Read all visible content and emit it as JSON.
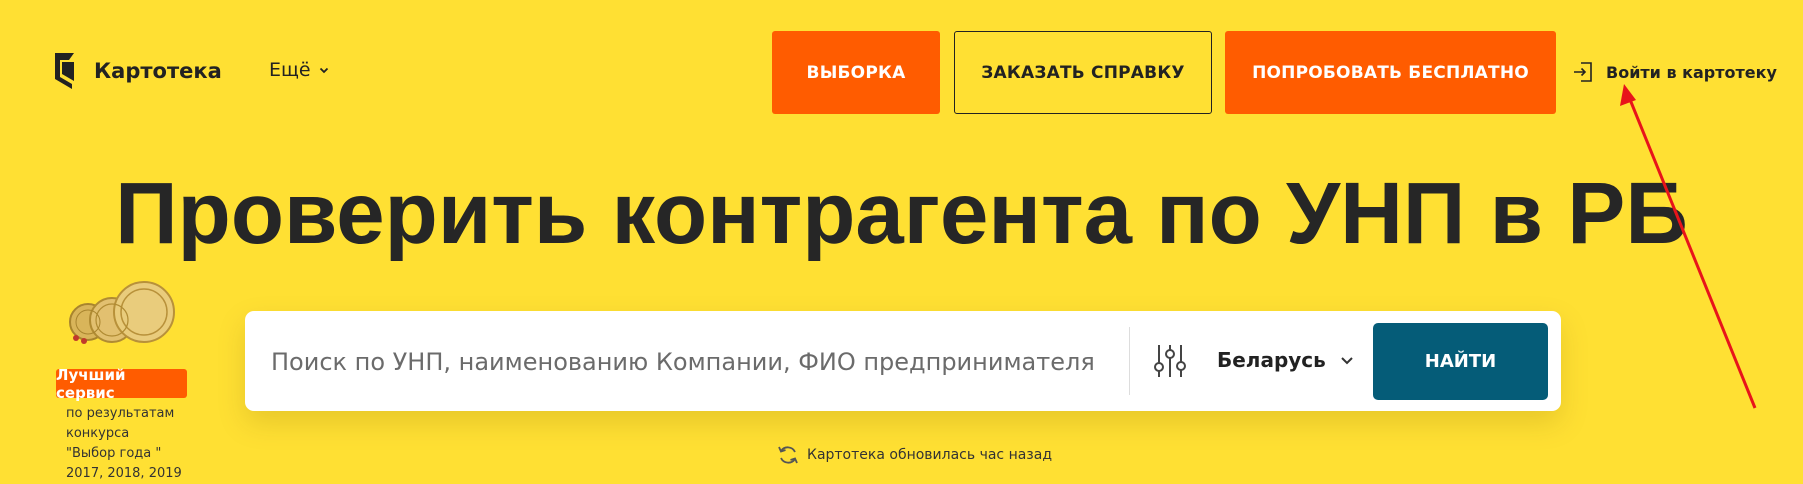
{
  "header": {
    "logo_text": "Картотека",
    "more_label": "Ещё",
    "buttons": {
      "selection": "ВЫБОРКА",
      "order_report": "ЗАКАЗАТЬ СПРАВКУ",
      "try_free": "ПОПРОБОВАТЬ БЕСПЛАТНО"
    },
    "login_label": "Войти в картотеку"
  },
  "main": {
    "title": "Проверить контрагента по УНП в РБ",
    "search": {
      "placeholder": "Поиск по УНП, наименованию Компании, ФИО предпринимателя",
      "value": "",
      "country": "Беларусь",
      "button_label": "НАЙТИ"
    },
    "updated_text": "Картотека обновилась час назад"
  },
  "award": {
    "badge_label": "Лучший сервис",
    "description_lines": [
      "по результатам",
      "конкурса",
      "\"Выбор года \"",
      "2017, 2018, 2019"
    ]
  },
  "icons": {
    "logo": "kartoteka-logo-icon",
    "more": "chevron-down-icon",
    "login": "login-icon",
    "filter": "filter-sliders-icon",
    "country": "chevron-down-icon",
    "refresh": "refresh-icon",
    "medals": "award-medals-icon"
  },
  "colors": {
    "background": "#ffe033",
    "accent_orange": "#ff5c00",
    "find_button": "#055c78",
    "annotation_arrow": "#e8141a"
  }
}
